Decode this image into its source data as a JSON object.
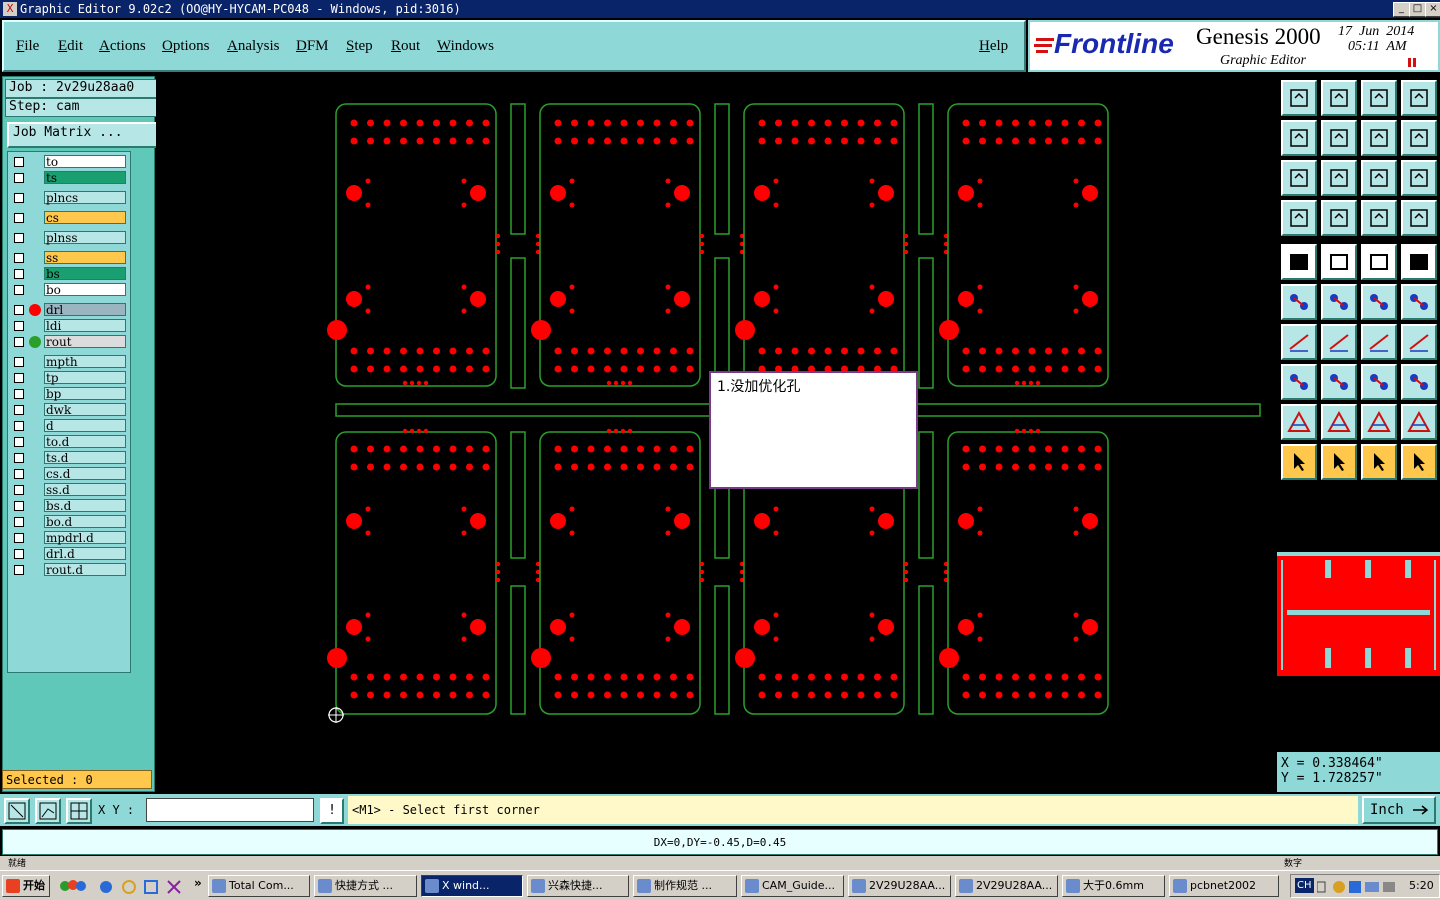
{
  "window": {
    "title": "Graphic Editor 9.02c2  (OO@HY-HYCAM-PC048 - Windows, pid:3016)",
    "minimize": "_",
    "maximize": "□",
    "close": "×"
  },
  "menu": {
    "items": [
      "File",
      "Edit",
      "Actions",
      "Options",
      "Analysis",
      "DFM",
      "Step",
      "Rout",
      "Windows"
    ],
    "help": "Help"
  },
  "brand": {
    "logo": "Frontline",
    "product": "Genesis 2000",
    "subtitle": "Graphic Editor",
    "date": "17  Jun  2014",
    "time": "05:11  AM"
  },
  "job": {
    "job_label": "Job : 2v29u28aa0",
    "step_label": "Step: cam",
    "matrix_button": "Job Matrix ..."
  },
  "layers": [
    {
      "name": "to",
      "color": "#ffffff",
      "dot": ""
    },
    {
      "name": "ts",
      "color": "#1aa070",
      "dot": ""
    },
    {
      "name": "plncs",
      "color": "#b6e6e6",
      "dot": ""
    },
    {
      "name": "cs",
      "color": "#ffc84d",
      "dot": ""
    },
    {
      "name": "plnss",
      "color": "#b6e6e6",
      "dot": ""
    },
    {
      "name": "ss",
      "color": "#ffc84d",
      "dot": ""
    },
    {
      "name": "bs",
      "color": "#1aa070",
      "dot": ""
    },
    {
      "name": "bo",
      "color": "#ffffff",
      "dot": ""
    },
    {
      "name": "drl",
      "color": "#9ab4c0",
      "dot": "#ff0000"
    },
    {
      "name": "ldi",
      "color": "#b6e6e6",
      "dot": ""
    },
    {
      "name": "rout",
      "color": "#dcdcdc",
      "dot": "#2aa02a"
    },
    {
      "name": "mpth",
      "color": "#b6e6e6",
      "dot": ""
    },
    {
      "name": "tp",
      "color": "#b6e6e6",
      "dot": ""
    },
    {
      "name": "bp",
      "color": "#b6e6e6",
      "dot": ""
    },
    {
      "name": "dwk",
      "color": "#b6e6e6",
      "dot": ""
    },
    {
      "name": "d",
      "color": "#b6e6e6",
      "dot": ""
    },
    {
      "name": "to.d",
      "color": "#b6e6e6",
      "dot": ""
    },
    {
      "name": "ts.d",
      "color": "#b6e6e6",
      "dot": ""
    },
    {
      "name": "cs.d",
      "color": "#b6e6e6",
      "dot": ""
    },
    {
      "name": "ss.d",
      "color": "#b6e6e6",
      "dot": ""
    },
    {
      "name": "bs.d",
      "color": "#b6e6e6",
      "dot": ""
    },
    {
      "name": "bo.d",
      "color": "#b6e6e6",
      "dot": ""
    },
    {
      "name": "mpdrl.d",
      "color": "#b6e6e6",
      "dot": ""
    },
    {
      "name": "drl.d",
      "color": "#b6e6e6",
      "dot": ""
    },
    {
      "name": "rout.d",
      "color": "#b6e6e6",
      "dot": ""
    }
  ],
  "selection": {
    "label": "Selected : 0"
  },
  "note": {
    "text": "1.没加优化孔"
  },
  "coords": {
    "x": "X  = 0.338464\"",
    "y": "Y  = 1.728257\""
  },
  "command": {
    "xy_label": "X Y :",
    "xy_value": "",
    "bang": "!",
    "prompt": "<M1> - Select first corner",
    "units": "Inch"
  },
  "status": {
    "measure": "DX=0,DY=-0.45,D=0.45",
    "left_hint": "就绪",
    "right_hint": "数字"
  },
  "taskbar": {
    "start": "开始",
    "tasks": [
      "Total Com...",
      "快捷方式 ...",
      "X wind...",
      "兴森快捷...",
      "制作规范 ...",
      "CAM_Guide...",
      "2V29U28AA...",
      "2V29U28AA...",
      "大于0.6mm",
      "pcbnet2002"
    ],
    "lang": "CH",
    "clock": "5:20"
  },
  "colors": {
    "outline": "#2aa02a",
    "drill": "#ff0000",
    "panel": "#8fd8d8"
  }
}
